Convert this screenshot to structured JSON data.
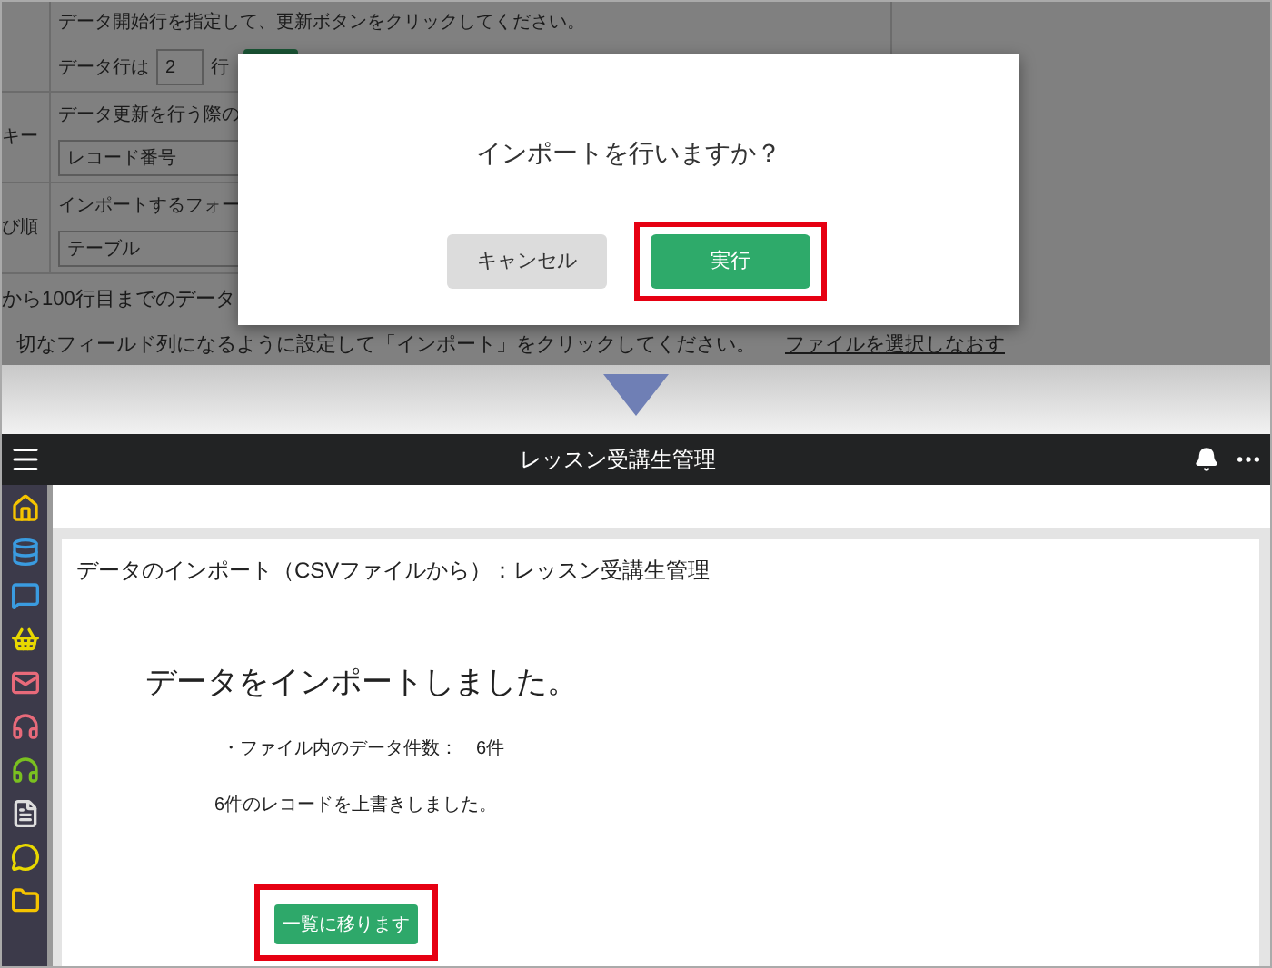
{
  "background_page": {
    "instruction": "データ開始行を指定して、更新ボタンをクリックしてください。",
    "data_row_label": "データ行は",
    "data_row_value": "2",
    "data_row_suffix": "行",
    "key_label": "キー",
    "key_hint": "データ更新を行う際の",
    "key_select": "レコード番号",
    "order_label": "び順",
    "order_hint": "インポートするフォー",
    "order_select": "テーブル",
    "note_1": "から100行目までのデータ",
    "note_2": "切なフィールド列になるように設定して「インポート」をクリックしてください。",
    "reselect_link": "ファイルを選択しなおす"
  },
  "confirm_dialog": {
    "message": "インポートを行いますか？",
    "buttons": [
      {
        "label": "キャンセル",
        "kind": "secondary",
        "highlighted": false
      },
      {
        "label": "実行",
        "kind": "primary",
        "highlighted": true
      }
    ]
  },
  "app": {
    "title": "レッスン受講生管理",
    "page_heading": "データのインポート（CSVファイルから）：レッスン受講生管理",
    "result_title": "データをインポートしました。",
    "file_count": "・ファイル内のデータ件数：　6件",
    "overwrite_message": "6件のレコードを上書きしました。",
    "back_button": {
      "label": "一覧に移ります",
      "highlighted": true
    }
  }
}
